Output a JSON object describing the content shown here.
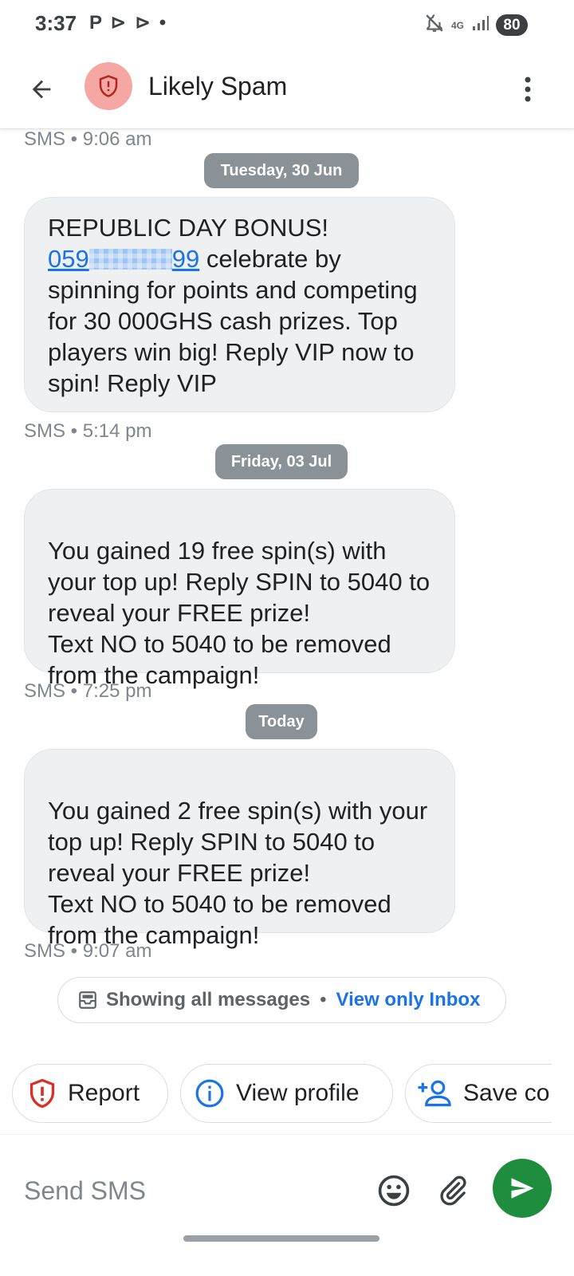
{
  "status_bar": {
    "time": "3:37",
    "notification_icons": "P ⊳ ⊳ •",
    "network": "4G",
    "battery": "80"
  },
  "app_bar": {
    "title": "Likely Spam"
  },
  "messages": [
    {
      "text_before_link": "REPUBLIC DAY BONUS!",
      "link_start": "059",
      "link_end": "99",
      "text_after_link": " celebrate by spinning for points and competing for 30 000GHS cash prizes. Top players win big! Reply VIP now to spin! Reply VIP"
    },
    {
      "text": "You gained 19 free spin(s) with your top up! Reply SPIN to 5040 to reveal your FREE prize!\nText NO to 5040 to be removed from the campaign!"
    },
    {
      "text": "You gained 2 free spin(s) with your top up! Reply SPIN to 5040 to reveal your FREE prize!\nText NO to 5040 to be removed from the campaign!"
    }
  ],
  "meta": {
    "top": "SMS • 9:06 am",
    "after_first": "SMS • 5:14 pm",
    "after_second": "SMS • 7:25 pm",
    "after_third": "SMS • 9:07 am"
  },
  "date_chips": {
    "first": "Tuesday, 30 Jun",
    "second": "Friday, 03 Jul",
    "third": "Today"
  },
  "filter": {
    "text": "Showing all messages",
    "separator": "•",
    "link": "View only Inbox"
  },
  "chips": {
    "report": "Report",
    "view_profile": "View profile",
    "save_contact": "Save co"
  },
  "compose": {
    "placeholder": "Send SMS"
  },
  "colors": {
    "accent": "#1a73e8",
    "send_button": "#1e8e3e",
    "spam_avatar": "#f4a7a3",
    "spam_red": "#d93025"
  }
}
